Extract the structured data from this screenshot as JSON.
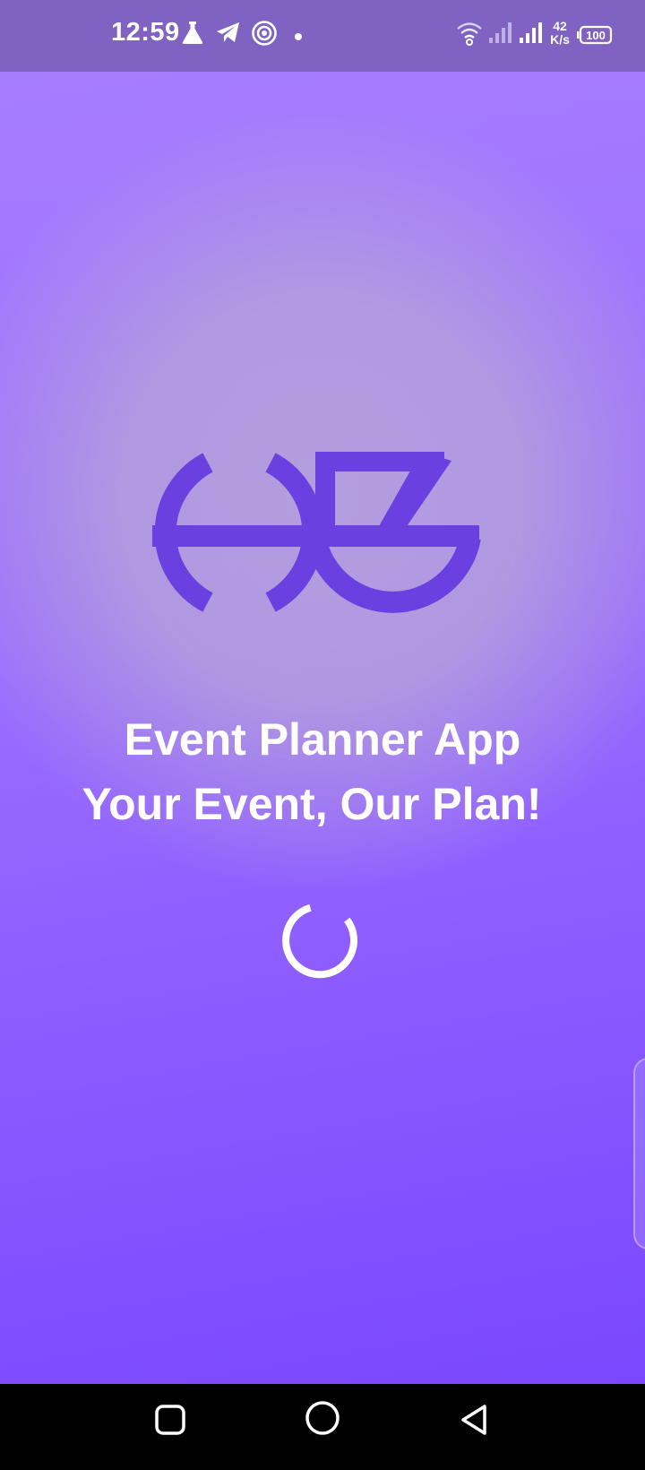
{
  "status_bar": {
    "time": "12:59",
    "network_speed_value": "42",
    "network_speed_unit": "K/s",
    "battery": "100",
    "icons": [
      "lab-flask-icon",
      "telegram-icon",
      "target-icon",
      "notification-dot-icon",
      "wifi-icon",
      "signal-sim1-icon",
      "signal-sim2-icon",
      "battery-icon"
    ]
  },
  "splash": {
    "logo": "event-planner-logo",
    "title": "Event Planner App",
    "tagline": "Your Event, Our Plan!"
  },
  "nav_bar": {
    "buttons": [
      "recents-square-icon",
      "home-circle-icon",
      "back-triangle-icon"
    ]
  },
  "colors": {
    "status_bar_bg": "#7f62c2",
    "background_top": "#a97fff",
    "background_bottom": "#7a47ff",
    "logo": "#6a41e0",
    "text": "#ffffff"
  }
}
